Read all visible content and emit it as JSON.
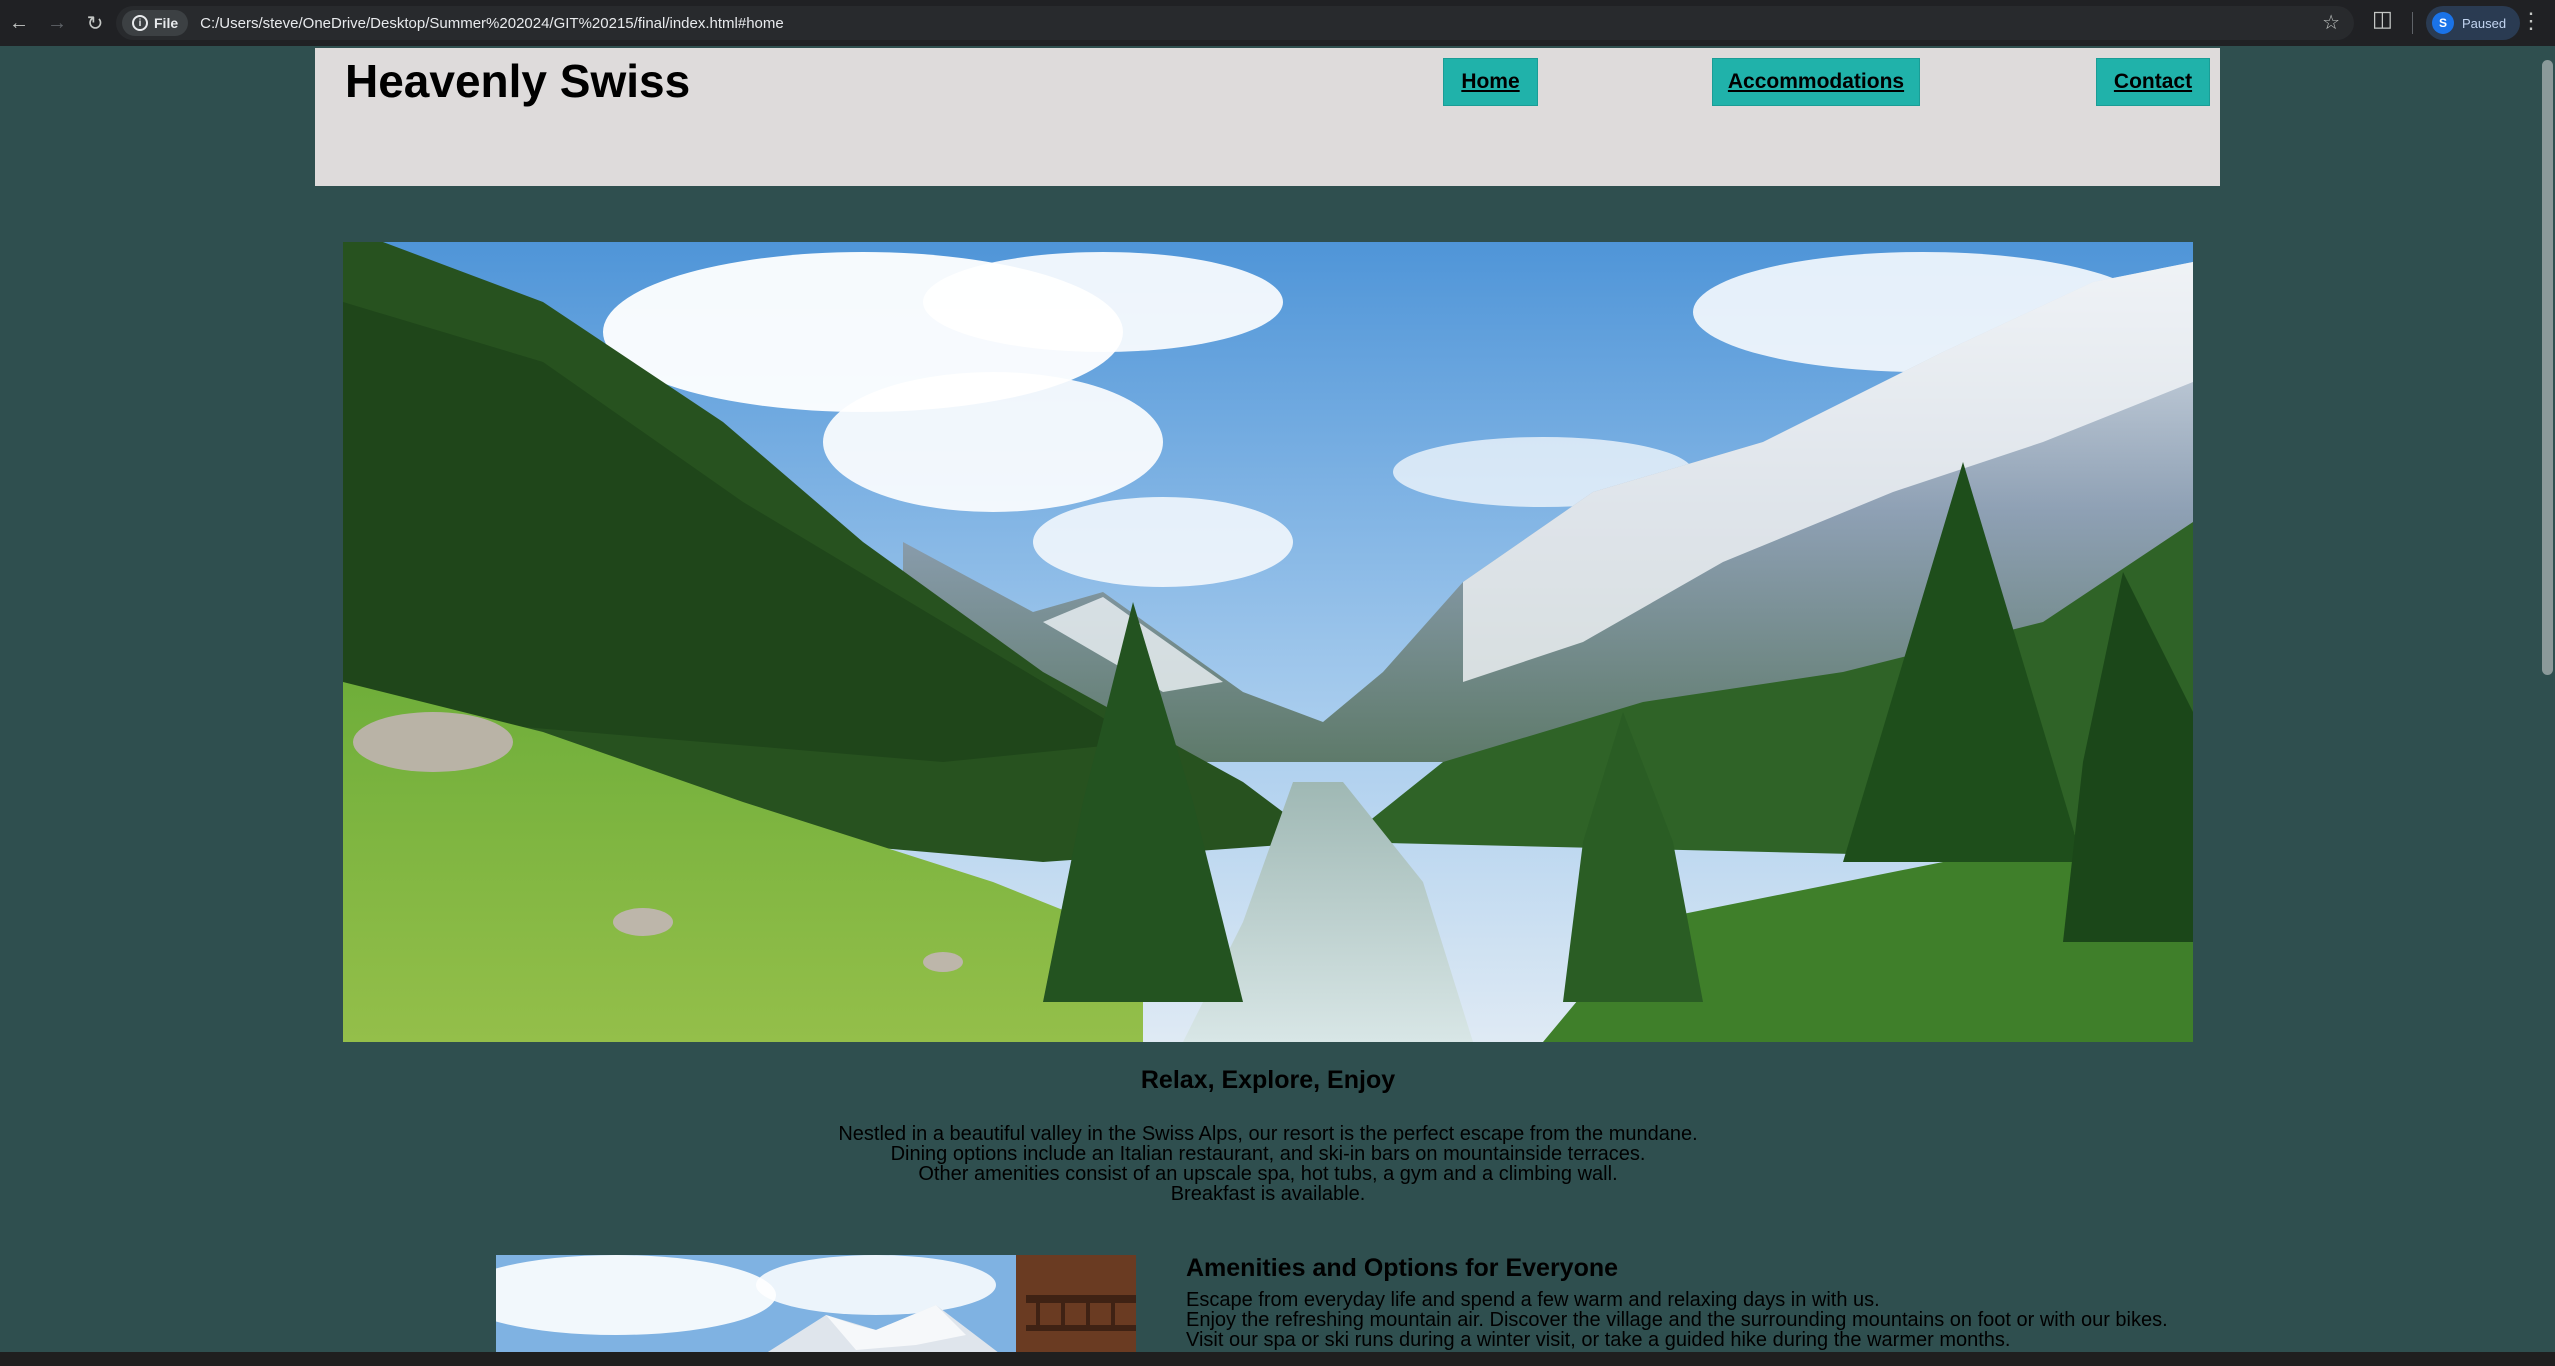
{
  "browser": {
    "file_label": "File",
    "url": "C:/Users/steve/OneDrive/Desktop/Summer%202024/GIT%20215/final/index.html#home",
    "profile_initial": "S",
    "profile_status": "Paused",
    "back_icon": "arrow-left-icon",
    "forward_icon": "arrow-right-icon",
    "reload_icon": "reload-icon",
    "bookmark_icon": "star-icon",
    "extensions_icon": "puzzle-icon",
    "menu_icon": "kebab-menu-icon"
  },
  "header": {
    "title": "Heavenly Swiss",
    "nav": [
      {
        "label": "Home"
      },
      {
        "label": "Accommodations"
      },
      {
        "label": "Contact"
      }
    ],
    "background_color": "#dedbdb",
    "nav_color": "#20b2aa"
  },
  "hero": {
    "image": "alpine-valley-with-river-photo"
  },
  "intro": {
    "heading": "Relax, Explore, Enjoy",
    "lines": [
      "Nestled in a beautiful valley in the Swiss Alps, our resort is the perfect escape from the mundane.",
      "Dining options include an Italian restaurant, and ski-in bars on mountainside terraces.",
      "Other amenities consist of an upscale spa, hot tubs, a gym and a climbing wall.",
      "Breakfast is available."
    ]
  },
  "amenities": {
    "heading": "Amenities and Options for Everyone",
    "lines": [
      "Escape from everyday life and spend a few warm and relaxing days in with us.",
      "Enjoy the refreshing mountain air. Discover the village and the surrounding mountains on foot or with our bikes.",
      "Visit our spa or ski runs during a winter visit, or take a guided hike during the warmer months."
    ],
    "image": "mountain-chalet-photo"
  },
  "page": {
    "background_color": "#2f4f4f"
  }
}
